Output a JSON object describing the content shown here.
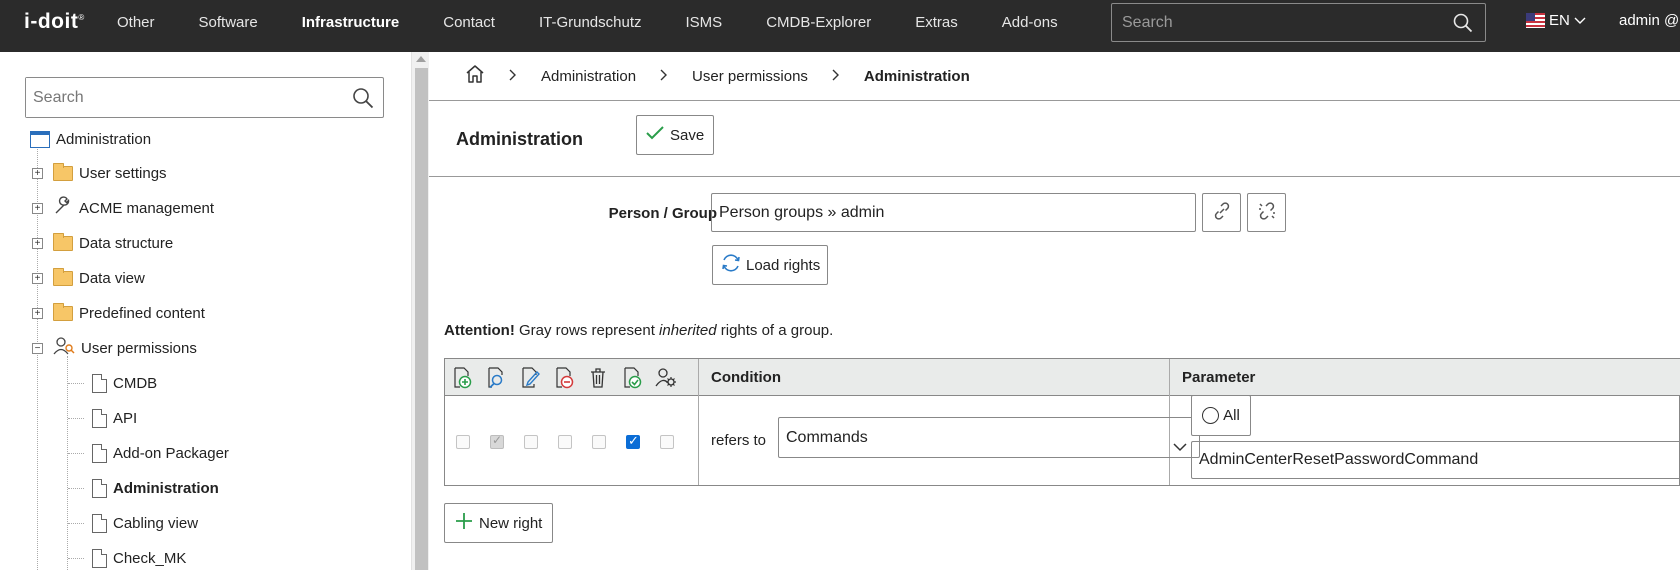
{
  "topbar": {
    "logo": "i-doit",
    "nav": [
      "Other",
      "Software",
      "Infrastructure",
      "Contact",
      "IT-Grundschutz",
      "ISMS",
      "CMDB-Explorer",
      "Extras",
      "Add-ons"
    ],
    "active_nav": "Infrastructure",
    "search_placeholder": "Search",
    "language": "EN",
    "user": "admin @"
  },
  "sidebar": {
    "search_placeholder": "Search",
    "root": "Administration",
    "items": [
      {
        "label": "User settings",
        "icon": "folder-icon"
      },
      {
        "label": "ACME management",
        "icon": "wrench-icon"
      },
      {
        "label": "Data structure",
        "icon": "folder-icon"
      },
      {
        "label": "Data view",
        "icon": "folder-icon"
      },
      {
        "label": "Predefined content",
        "icon": "folder-icon"
      },
      {
        "label": "User permissions",
        "icon": "user-permissions-icon",
        "expanded": true
      }
    ],
    "children": [
      {
        "label": "CMDB"
      },
      {
        "label": "API"
      },
      {
        "label": "Add-on Packager"
      },
      {
        "label": "Administration",
        "selected": true
      },
      {
        "label": "Cabling view"
      },
      {
        "label": "Check_MK"
      }
    ]
  },
  "breadcrumb": {
    "items": [
      "Administration",
      "User permissions",
      "Administration"
    ]
  },
  "page": {
    "title": "Administration",
    "save_label": "Save"
  },
  "form": {
    "person_group_label": "Person / Group",
    "person_group_value": "Person groups » admin",
    "load_rights_label": "Load rights"
  },
  "attention": {
    "strong": "Attention!",
    "text1": " Gray rows represent ",
    "em": "inherited",
    "text2": " rights of a group."
  },
  "rights_table": {
    "header_icons": [
      "create-icon",
      "view-icon",
      "edit-icon",
      "archive-icon",
      "delete-icon",
      "execute-icon",
      "supervisor-icon"
    ],
    "condition_header": "Condition",
    "parameter_header": "Parameter",
    "row": {
      "checkboxes": [
        "unchecked",
        "checked-gray",
        "unchecked",
        "unchecked",
        "unchecked",
        "checked",
        "unchecked"
      ],
      "refers_label": "refers to",
      "condition_value": "Commands",
      "all_label": "All",
      "parameter_value": "AdminCenterResetPasswordCommand"
    }
  },
  "new_right_label": "New right",
  "colors": {
    "topbar_bg": "#2b2b2b",
    "accent_blue": "#0b6dd6",
    "table_header_bg": "#e9ebea",
    "green_icon": "#2a9d4a",
    "red_icon": "#d33a3a"
  }
}
